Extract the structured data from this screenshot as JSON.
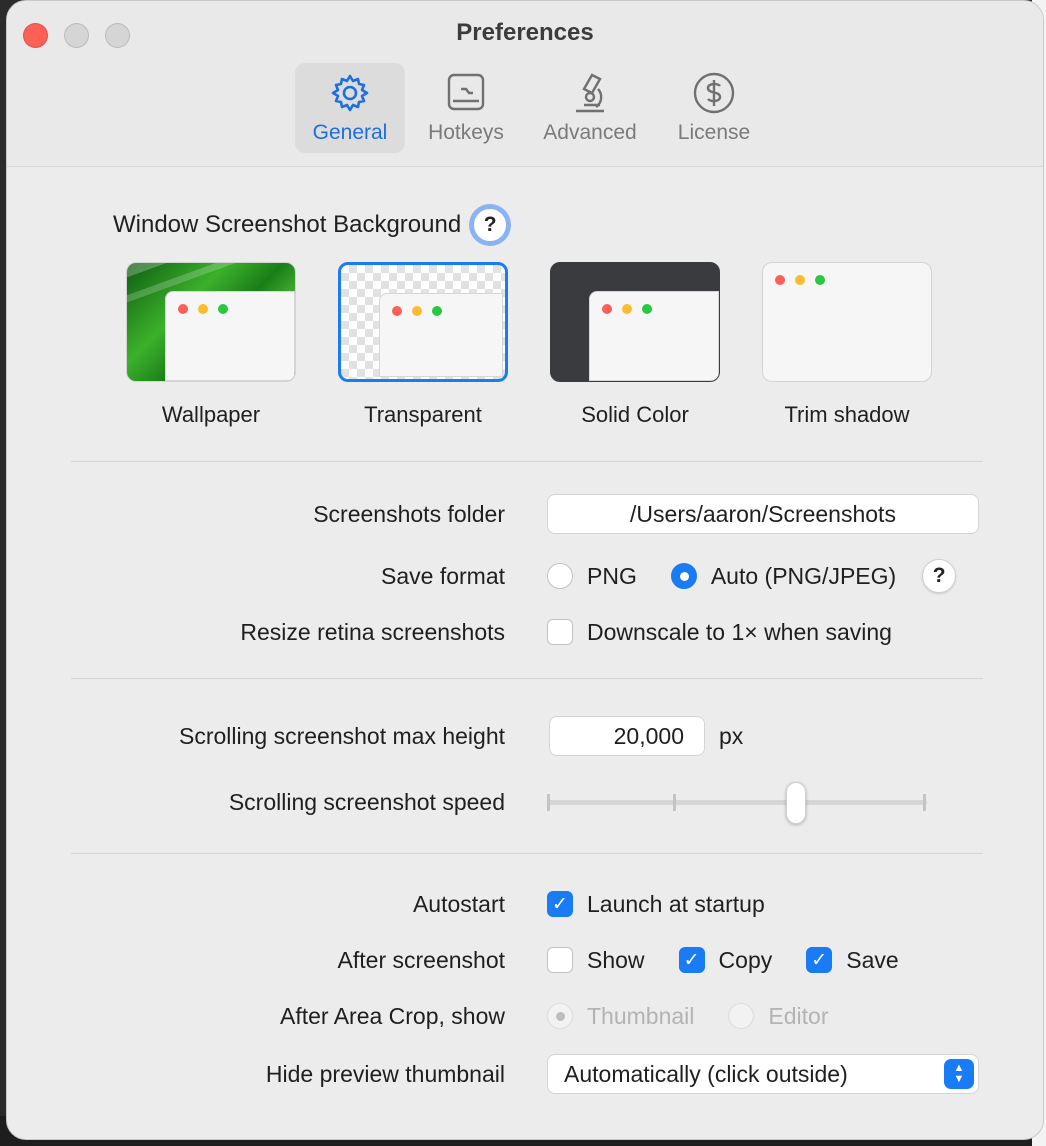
{
  "window": {
    "title": "Preferences"
  },
  "toolbar": {
    "items": [
      {
        "label": "General",
        "icon": "gear-icon",
        "selected": true
      },
      {
        "label": "Hotkeys",
        "icon": "keyboard-icon",
        "selected": false
      },
      {
        "label": "Advanced",
        "icon": "microscope-icon",
        "selected": false
      },
      {
        "label": "License",
        "icon": "dollar-circle-icon",
        "selected": false
      }
    ]
  },
  "background_section": {
    "title": "Window Screenshot Background",
    "help": "?",
    "options": [
      {
        "label": "Wallpaper",
        "selected": false
      },
      {
        "label": "Transparent",
        "selected": true
      },
      {
        "label": "Solid Color",
        "selected": false
      },
      {
        "label": "Trim shadow",
        "selected": false
      }
    ]
  },
  "folder": {
    "label": "Screenshots folder",
    "value": "/Users/aaron/Screenshots"
  },
  "save_format": {
    "label": "Save format",
    "options": [
      {
        "label": "PNG",
        "selected": false
      },
      {
        "label": "Auto (PNG/JPEG)",
        "selected": true
      }
    ],
    "help": "?"
  },
  "resize_retina": {
    "label": "Resize retina screenshots",
    "checkbox_label": "Downscale to 1× when saving",
    "checked": false
  },
  "scroll_max": {
    "label": "Scrolling screenshot max height",
    "value": "20,000",
    "unit": "px"
  },
  "scroll_speed": {
    "label": "Scrolling screenshot speed",
    "level": 0.66
  },
  "autostart": {
    "label": "Autostart",
    "checkbox_label": "Launch at startup",
    "checked": true
  },
  "after_screenshot": {
    "label": "After screenshot",
    "options": [
      {
        "label": "Show",
        "checked": false
      },
      {
        "label": "Copy",
        "checked": true
      },
      {
        "label": "Save",
        "checked": true
      }
    ]
  },
  "after_crop": {
    "label": "After Area Crop, show",
    "options": [
      {
        "label": "Thumbnail",
        "selected": true
      },
      {
        "label": "Editor",
        "selected": false
      }
    ]
  },
  "hide_preview": {
    "label": "Hide preview thumbnail",
    "value": "Automatically (click outside)"
  },
  "colors": {
    "accent": "#1a7cf5",
    "close": "#fe5f57"
  }
}
